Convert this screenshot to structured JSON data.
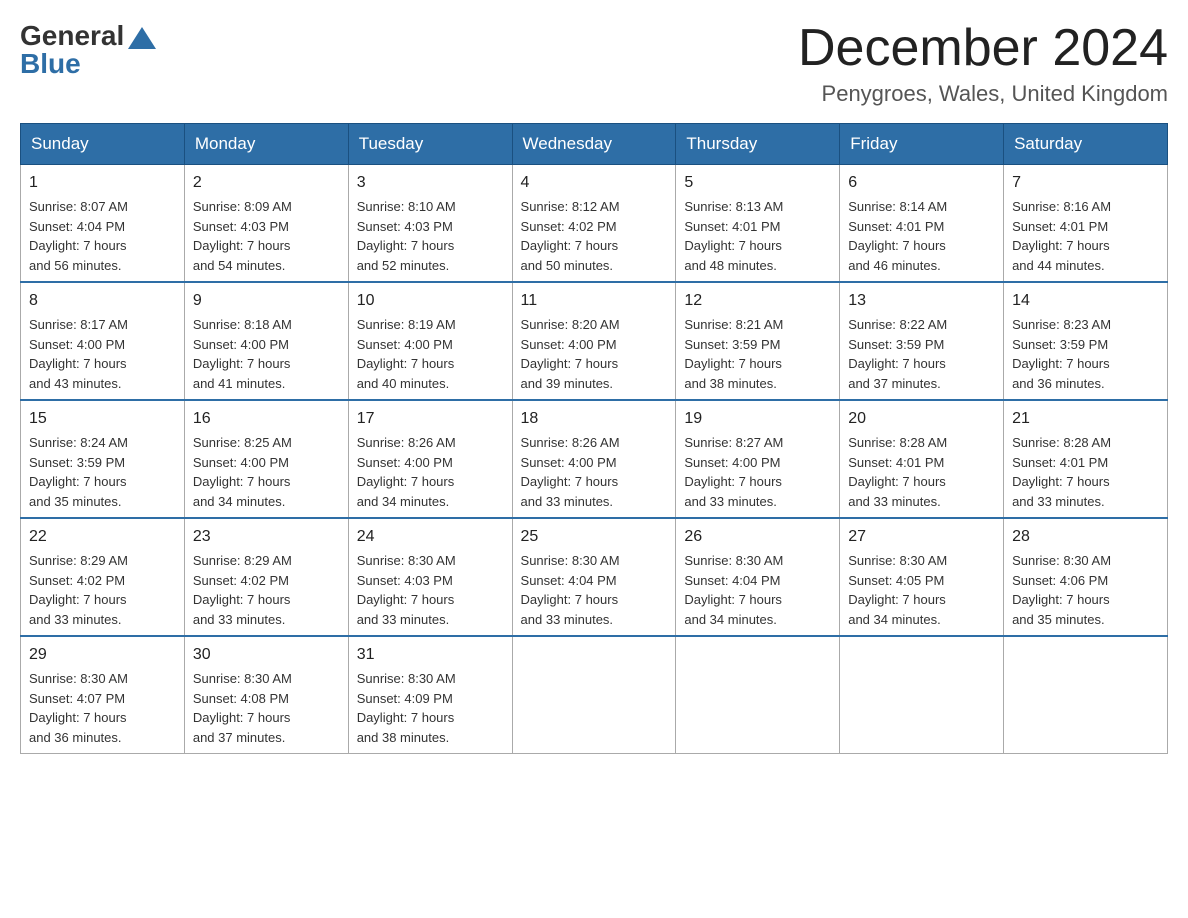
{
  "logo": {
    "general": "General",
    "blue": "Blue"
  },
  "header": {
    "title": "December 2024",
    "subtitle": "Penygroes, Wales, United Kingdom"
  },
  "weekdays": [
    "Sunday",
    "Monday",
    "Tuesday",
    "Wednesday",
    "Thursday",
    "Friday",
    "Saturday"
  ],
  "weeks": [
    [
      {
        "day": "1",
        "sunrise": "8:07 AM",
        "sunset": "4:04 PM",
        "daylight": "7 hours and 56 minutes."
      },
      {
        "day": "2",
        "sunrise": "8:09 AM",
        "sunset": "4:03 PM",
        "daylight": "7 hours and 54 minutes."
      },
      {
        "day": "3",
        "sunrise": "8:10 AM",
        "sunset": "4:03 PM",
        "daylight": "7 hours and 52 minutes."
      },
      {
        "day": "4",
        "sunrise": "8:12 AM",
        "sunset": "4:02 PM",
        "daylight": "7 hours and 50 minutes."
      },
      {
        "day": "5",
        "sunrise": "8:13 AM",
        "sunset": "4:01 PM",
        "daylight": "7 hours and 48 minutes."
      },
      {
        "day": "6",
        "sunrise": "8:14 AM",
        "sunset": "4:01 PM",
        "daylight": "7 hours and 46 minutes."
      },
      {
        "day": "7",
        "sunrise": "8:16 AM",
        "sunset": "4:01 PM",
        "daylight": "7 hours and 44 minutes."
      }
    ],
    [
      {
        "day": "8",
        "sunrise": "8:17 AM",
        "sunset": "4:00 PM",
        "daylight": "7 hours and 43 minutes."
      },
      {
        "day": "9",
        "sunrise": "8:18 AM",
        "sunset": "4:00 PM",
        "daylight": "7 hours and 41 minutes."
      },
      {
        "day": "10",
        "sunrise": "8:19 AM",
        "sunset": "4:00 PM",
        "daylight": "7 hours and 40 minutes."
      },
      {
        "day": "11",
        "sunrise": "8:20 AM",
        "sunset": "4:00 PM",
        "daylight": "7 hours and 39 minutes."
      },
      {
        "day": "12",
        "sunrise": "8:21 AM",
        "sunset": "3:59 PM",
        "daylight": "7 hours and 38 minutes."
      },
      {
        "day": "13",
        "sunrise": "8:22 AM",
        "sunset": "3:59 PM",
        "daylight": "7 hours and 37 minutes."
      },
      {
        "day": "14",
        "sunrise": "8:23 AM",
        "sunset": "3:59 PM",
        "daylight": "7 hours and 36 minutes."
      }
    ],
    [
      {
        "day": "15",
        "sunrise": "8:24 AM",
        "sunset": "3:59 PM",
        "daylight": "7 hours and 35 minutes."
      },
      {
        "day": "16",
        "sunrise": "8:25 AM",
        "sunset": "4:00 PM",
        "daylight": "7 hours and 34 minutes."
      },
      {
        "day": "17",
        "sunrise": "8:26 AM",
        "sunset": "4:00 PM",
        "daylight": "7 hours and 34 minutes."
      },
      {
        "day": "18",
        "sunrise": "8:26 AM",
        "sunset": "4:00 PM",
        "daylight": "7 hours and 33 minutes."
      },
      {
        "day": "19",
        "sunrise": "8:27 AM",
        "sunset": "4:00 PM",
        "daylight": "7 hours and 33 minutes."
      },
      {
        "day": "20",
        "sunrise": "8:28 AM",
        "sunset": "4:01 PM",
        "daylight": "7 hours and 33 minutes."
      },
      {
        "day": "21",
        "sunrise": "8:28 AM",
        "sunset": "4:01 PM",
        "daylight": "7 hours and 33 minutes."
      }
    ],
    [
      {
        "day": "22",
        "sunrise": "8:29 AM",
        "sunset": "4:02 PM",
        "daylight": "7 hours and 33 minutes."
      },
      {
        "day": "23",
        "sunrise": "8:29 AM",
        "sunset": "4:02 PM",
        "daylight": "7 hours and 33 minutes."
      },
      {
        "day": "24",
        "sunrise": "8:30 AM",
        "sunset": "4:03 PM",
        "daylight": "7 hours and 33 minutes."
      },
      {
        "day": "25",
        "sunrise": "8:30 AM",
        "sunset": "4:04 PM",
        "daylight": "7 hours and 33 minutes."
      },
      {
        "day": "26",
        "sunrise": "8:30 AM",
        "sunset": "4:04 PM",
        "daylight": "7 hours and 34 minutes."
      },
      {
        "day": "27",
        "sunrise": "8:30 AM",
        "sunset": "4:05 PM",
        "daylight": "7 hours and 34 minutes."
      },
      {
        "day": "28",
        "sunrise": "8:30 AM",
        "sunset": "4:06 PM",
        "daylight": "7 hours and 35 minutes."
      }
    ],
    [
      {
        "day": "29",
        "sunrise": "8:30 AM",
        "sunset": "4:07 PM",
        "daylight": "7 hours and 36 minutes."
      },
      {
        "day": "30",
        "sunrise": "8:30 AM",
        "sunset": "4:08 PM",
        "daylight": "7 hours and 37 minutes."
      },
      {
        "day": "31",
        "sunrise": "8:30 AM",
        "sunset": "4:09 PM",
        "daylight": "7 hours and 38 minutes."
      },
      null,
      null,
      null,
      null
    ]
  ],
  "labels": {
    "sunrise": "Sunrise:",
    "sunset": "Sunset:",
    "daylight": "Daylight:"
  }
}
